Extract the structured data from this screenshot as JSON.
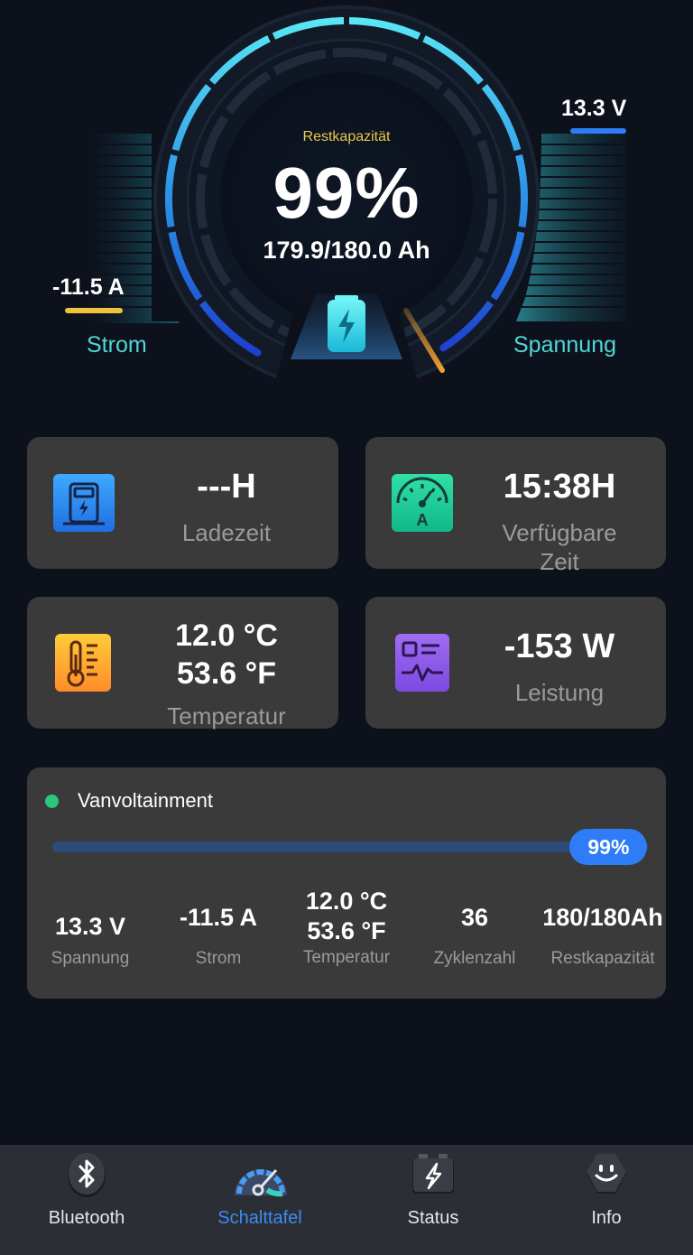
{
  "gauge": {
    "capacity_label": "Restkapazität",
    "percent": "99%",
    "percent_fraction": 0.99,
    "amp_hours": "179.9/180.0 Ah",
    "current_value": "-11.5 A",
    "current_label": "Strom",
    "voltage_value": "13.3 V",
    "voltage_label": "Spannung",
    "battery_icon": "battery-charging-icon"
  },
  "cards": {
    "charge_time": {
      "value": "---H",
      "label": "Ladezeit",
      "icon": "charger-icon"
    },
    "available_time": {
      "value": "15:38H",
      "label": "Verfügbare Zeit",
      "icon": "ammeter-icon"
    },
    "temperature": {
      "value_c": "12.0 °C",
      "value_f": "53.6 °F",
      "label": "Temperatur",
      "icon": "thermometer-icon"
    },
    "power": {
      "value": "-153 W",
      "label": "Leistung",
      "icon": "monitor-chart-icon"
    }
  },
  "battery": {
    "name": "Vanvoltainment",
    "status_color": "#28c87a",
    "progress_label": "99%",
    "progress_fraction": 0.99,
    "stats": {
      "voltage": {
        "value": "13.3 V",
        "label": "Spannung"
      },
      "current": {
        "value": "-11.5 A",
        "label": "Strom"
      },
      "temperature": {
        "value_c": "12.0 °C",
        "value_f": "53.6 °F",
        "label": "Temperatur"
      },
      "cycles": {
        "value": "36",
        "label": "Zyklenzahl"
      },
      "capacity": {
        "value": "180/180Ah",
        "label": "Restkapazität"
      }
    }
  },
  "tabs": [
    {
      "label": "Bluetooth",
      "icon": "bluetooth-icon",
      "active": false
    },
    {
      "label": "Schalttafel",
      "icon": "dashboard-gauge-icon",
      "active": true
    },
    {
      "label": "Status",
      "icon": "battery-status-icon",
      "active": false
    },
    {
      "label": "Info",
      "icon": "smiley-info-icon",
      "active": false
    }
  ],
  "colors": {
    "background": "#0d111c",
    "card": "#3a3a3a",
    "accent_blue": "#2f7df6",
    "accent_cyan": "#4fd8d6",
    "current_yellow": "#f0c33c",
    "capacity_label_yellow": "#e8c84a"
  }
}
